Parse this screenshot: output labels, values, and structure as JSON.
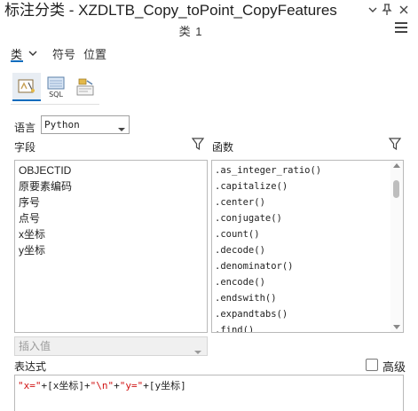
{
  "window": {
    "title": "标注分类 - XZDLTB_Copy_toPoint_CopyFeatures",
    "subtitle": "类 1"
  },
  "tabs": [
    {
      "label": "类",
      "active": true
    },
    {
      "label": "符号",
      "active": false
    },
    {
      "label": "位置",
      "active": false
    }
  ],
  "modes": [
    {
      "name": "expression-mode",
      "active": true
    },
    {
      "name": "sql-mode",
      "label": "SQL",
      "active": false
    },
    {
      "name": "other-mode",
      "active": false
    }
  ],
  "language": {
    "label": "语言",
    "value": "Python"
  },
  "fields": {
    "label": "字段",
    "items": [
      "OBJECTID",
      "原要素编码",
      "序号",
      "点号",
      "x坐标",
      "y坐标"
    ]
  },
  "functions": {
    "label": "函数",
    "items": [
      ".as_integer_ratio()",
      ".capitalize()",
      ".center()",
      ".conjugate()",
      ".count()",
      ".decode()",
      ".denominator()",
      ".encode()",
      ".endswith()",
      ".expandtabs()",
      ".find()"
    ]
  },
  "insert_values": {
    "placeholder": "插入值"
  },
  "expression": {
    "label": "表达式",
    "advanced_label": "高级",
    "advanced_checked": false,
    "tokens": [
      {
        "type": "str",
        "text": "\"x=\""
      },
      {
        "type": "op",
        "text": "+"
      },
      {
        "type": "field",
        "text": "[x坐标]"
      },
      {
        "type": "op",
        "text": "+"
      },
      {
        "type": "str",
        "text": "\"\\n\""
      },
      {
        "type": "op",
        "text": "+"
      },
      {
        "type": "str",
        "text": "\"y=\""
      },
      {
        "type": "op",
        "text": "+"
      },
      {
        "type": "field",
        "text": "[y坐标]"
      }
    ]
  },
  "colors": {
    "accent": "#0f6cbd",
    "string": "#d11313"
  }
}
